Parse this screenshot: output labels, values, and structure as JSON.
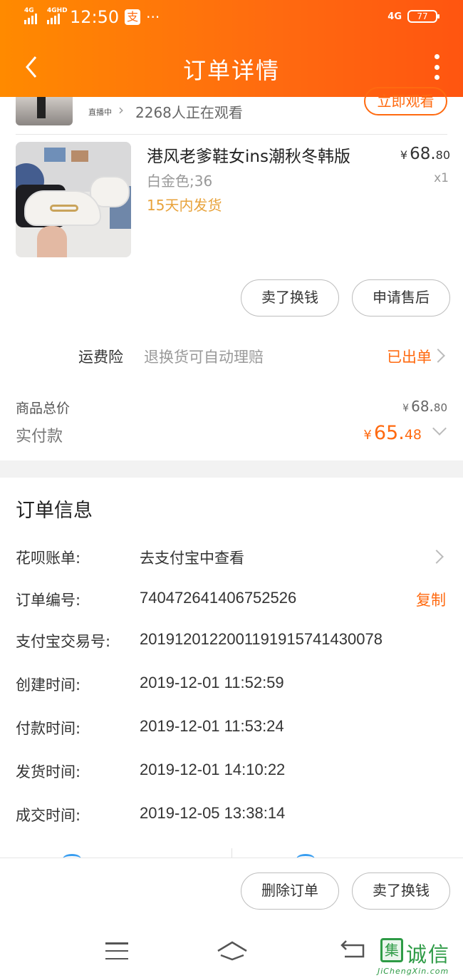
{
  "status_bar": {
    "signal_1": "4G",
    "signal_2": "4GHD",
    "time": "12:50",
    "app_icon_text": "支",
    "more": "···",
    "network": "4G",
    "battery": "77"
  },
  "nav": {
    "title": "订单详情"
  },
  "live": {
    "tag": "直播中",
    "viewers": "2268人正在观看",
    "watch_button": "立即观看"
  },
  "product": {
    "name": "港风老爹鞋女ins潮秋冬韩版",
    "sku": "白金色;36",
    "shipping_note": "15天内发货",
    "price_currency": "¥",
    "price_int": "68.",
    "price_dec": "80",
    "quantity": "x1"
  },
  "item_actions": {
    "sell_button": "卖了换钱",
    "after_sale_button": "申请售后"
  },
  "insurance": {
    "label": "运费险",
    "description": "退换货可自动理赔",
    "status": "已出单"
  },
  "totals": {
    "goods_total_label": "商品总价",
    "goods_total_currency": "¥",
    "goods_total_int": "68.",
    "goods_total_dec": "80",
    "paid_label": "实付款",
    "paid_currency": "¥",
    "paid_int": "65.",
    "paid_dec": "48"
  },
  "order_info": {
    "title": "订单信息",
    "huabei_label": "花呗账单:",
    "huabei_value": "去支付宝中查看",
    "order_no_label": "订单编号:",
    "order_no_value": "740472641406752526",
    "copy_label": "复制",
    "alipay_no_label": "支付宝交易号:",
    "alipay_no_value": "2019120122001191915741430078",
    "created_label": "创建时间:",
    "created_value": "2019-12-01 11:52:59",
    "paid_time_label": "付款时间:",
    "paid_time_value": "2019-12-01 11:53:24",
    "shipped_label": "发货时间:",
    "shipped_value": "2019-12-01 14:10:22",
    "completed_label": "成交时间:",
    "completed_value": "2019-12-05 13:38:14"
  },
  "bottom_actions": {
    "delete_button": "删除订单",
    "sell_button": "卖了换钱"
  },
  "watermark": {
    "logo": "集",
    "name": "诚信",
    "url": "JiChengXin.com"
  },
  "colors": {
    "accent": "#ff6a10",
    "header_gradient_start": "#ff8a00",
    "header_gradient_end": "#ff5510",
    "shipping_note": "#e8a33c"
  }
}
